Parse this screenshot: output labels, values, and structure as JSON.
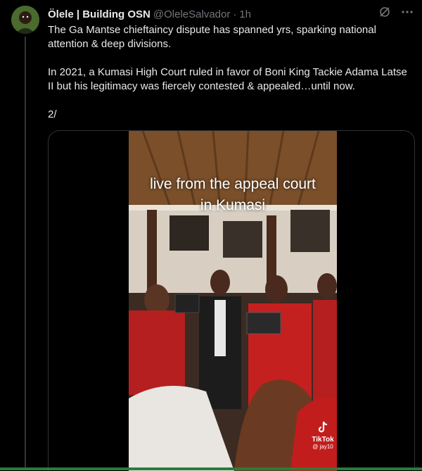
{
  "tweet": {
    "author_name": "Ölele | Building OSN",
    "handle": "@OleleSalvador",
    "separator": "·",
    "time": "1h",
    "paragraphs": [
      "The Ga Mantse chieftaincy dispute has spanned yrs, sparking national attention & deep divisions.",
      "In 2021, a Kumasi High Court ruled in favor of Boni King Tackie Adama Latse II but his legitimacy was fiercely contested & appealed…until now.",
      "2/"
    ],
    "actions": [
      {
        "icon": "grok-icon"
      },
      {
        "icon": "more-icon"
      }
    ]
  },
  "media": {
    "caption_line1": "live from the appeal court",
    "caption_line2": "in Kumasi",
    "watermark": "TikTok",
    "watermark_user": "@ jay10"
  },
  "colors": {
    "background": "#000000",
    "text": "#e7e9ea",
    "muted": "#71767b",
    "border": "#2f3336"
  }
}
